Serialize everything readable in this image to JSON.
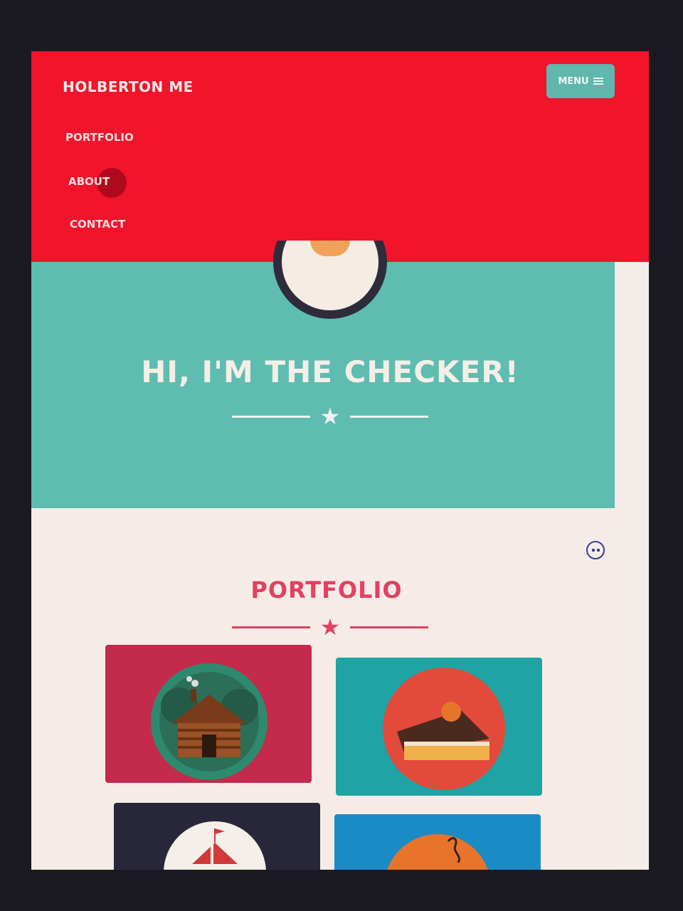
{
  "nav": {
    "brand": "HOLBERTON ME",
    "menu_label": "MENU",
    "links": [
      {
        "label": "PORTFOLIO"
      },
      {
        "label": "ABOUT"
      },
      {
        "label": "CONTACT"
      }
    ]
  },
  "hero": {
    "title": "HI, I'M THE CHECKER!"
  },
  "portfolio": {
    "title": "PORTFOLIO",
    "items": [
      {
        "icon": "cabin-icon",
        "color": "#c32a4c"
      },
      {
        "icon": "cake-icon",
        "color": "#1fa3a4"
      },
      {
        "icon": "circus-tent-icon",
        "color": "#27263a"
      },
      {
        "icon": "game-controller-icon",
        "color": "#1b8bc6"
      }
    ]
  },
  "colors": {
    "navbar": "#f1142a",
    "hero": "#5fbcb1",
    "accent": "#e3405f",
    "menu_button": "#5fb7ad"
  }
}
